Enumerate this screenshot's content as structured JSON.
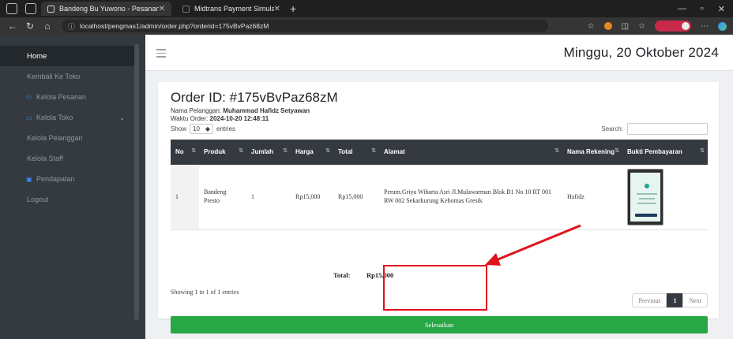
{
  "browser": {
    "tabs": [
      {
        "title": "Bandeng Bu Yuwono - Pesanan M",
        "active": true
      },
      {
        "title": "Midtrans Payment Simulator",
        "active": false
      }
    ],
    "url": "localhost/pengmas1/admin/order.php?orderid=175vBvPaz68zM",
    "new_tab_glyph": "+",
    "icons": [
      "sidebar-icon",
      "tab-icon",
      "back-icon",
      "refresh-icon",
      "home-icon",
      "info-icon",
      "favorite-icon",
      "extension-icon",
      "collections-icon",
      "profile-icon",
      "more-icon",
      "copilot-icon"
    ]
  },
  "sidebar": {
    "items": [
      {
        "label": "Home",
        "active": true
      },
      {
        "label": "Kembali Ke Toko"
      },
      {
        "label": "Kelola Pesanan",
        "icon": "users-icon"
      },
      {
        "label": "Kelola Toko",
        "icon": "store-icon",
        "has_chevron": true
      },
      {
        "label": "Kelola Pelanggan"
      },
      {
        "label": "Kelola Staff"
      },
      {
        "label": "Pendapatan",
        "icon": "money-icon"
      },
      {
        "label": "Logout"
      }
    ]
  },
  "header": {
    "date": "Minggu, 20 Oktober 2024"
  },
  "order": {
    "title": "Order ID: #175vBvPaz68zM",
    "customer_label": "Nama Pelanggan:",
    "customer_name": "Muhammad Hafidz Setyawan",
    "time_label": "Waktu Order:",
    "time_value": "2024-10-20 12:48:11"
  },
  "table_controls": {
    "show_label": "Show",
    "page_size": "10",
    "entries_label": "entries",
    "search_label": "Search:"
  },
  "table": {
    "columns": [
      "No",
      "Produk",
      "Jumlah",
      "Harga",
      "Total",
      "Alamat",
      "Nama Rekening",
      "Bukti Pembayaran"
    ],
    "rows": [
      {
        "no": "1",
        "produk": "Bandeng Presto",
        "jumlah": "1",
        "harga": "Rp15,000",
        "total": "Rp15,000",
        "alamat": "Perum.Griya Wiharta Asri Jl.Mulawarman Blok B1 No 10 RT 001 RW 002 Sekarkurung Kebomas Gresik",
        "rekening": "Hafidz",
        "bukti": "payment-proof-thumbnail"
      }
    ],
    "footer_total_label": "Total:",
    "footer_total_value": "Rp15,000"
  },
  "pagination": {
    "info": "Showing 1 to 1 of 1 entries",
    "previous": "Previous",
    "current": "1",
    "next": "Next"
  },
  "actions": {
    "finish_label": "Selesaikan"
  },
  "annotation": {
    "color": "#e0131d"
  },
  "colors": {
    "sidebar_bg": "#343a40",
    "table_header_bg": "#343a40",
    "finish_button": "#28a745",
    "annotation_red": "#e0131d"
  }
}
